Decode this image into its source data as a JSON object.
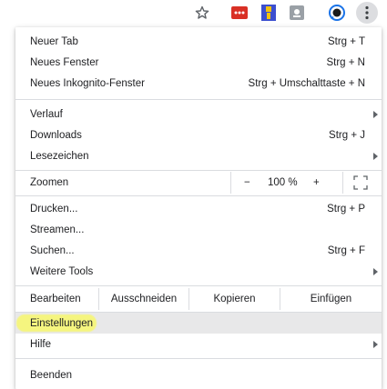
{
  "toolbar": {
    "icons": [
      "bookmark-star-icon",
      "red-extension-icon",
      "blue-extension-icon",
      "gray-extension-icon",
      "profile-icon",
      "more-menu-icon"
    ]
  },
  "menu": {
    "group1": [
      {
        "label": "Neuer Tab",
        "shortcut": "Strg + T"
      },
      {
        "label": "Neues Fenster",
        "shortcut": "Strg + N"
      },
      {
        "label": "Neues Inkognito-Fenster",
        "shortcut": "Strg + Umschalttaste + N"
      }
    ],
    "group2": [
      {
        "label": "Verlauf",
        "shortcut": ""
      },
      {
        "label": "Downloads",
        "shortcut": "Strg + J"
      },
      {
        "label": "Lesezeichen",
        "shortcut": ""
      }
    ],
    "zoom": {
      "label": "Zoomen",
      "minus": "−",
      "value": "100 %",
      "plus": "+"
    },
    "group3": [
      {
        "label": "Drucken...",
        "shortcut": "Strg + P"
      },
      {
        "label": "Streamen...",
        "shortcut": ""
      },
      {
        "label": "Suchen...",
        "shortcut": "Strg + F"
      },
      {
        "label": "Weitere Tools",
        "shortcut": ""
      }
    ],
    "edit": {
      "label": "Bearbeiten",
      "cut": "Ausschneiden",
      "copy": "Kopieren",
      "paste": "Einfügen"
    },
    "settings": {
      "label": "Einstellungen"
    },
    "help": {
      "label": "Hilfe"
    },
    "exit": {
      "label": "Beenden"
    }
  },
  "colors": {
    "highlight": "#f6f67a",
    "hover_row": "#e8e8e9",
    "separator": "#dadce0"
  }
}
